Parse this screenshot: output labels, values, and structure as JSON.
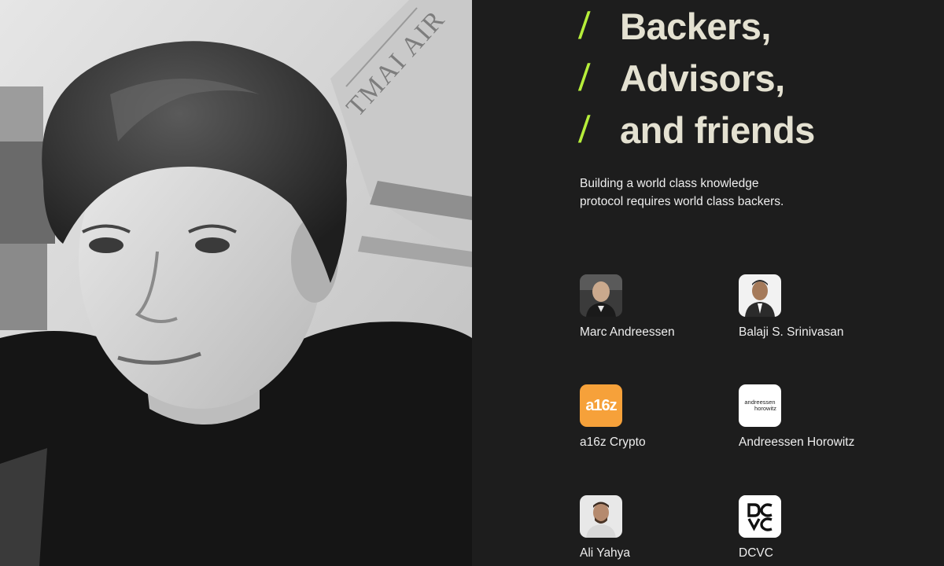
{
  "heading": {
    "lines": [
      "Backers,",
      "Advisors,",
      "and friends"
    ],
    "slash": "/"
  },
  "intro": "Building a world class knowledge protocol requires world class backers.",
  "backers": [
    {
      "name": "Marc Andreessen",
      "logo": "portrait"
    },
    {
      "name": "Balaji S. Srinivasan",
      "logo": "portrait"
    },
    {
      "name": "a16z Crypto",
      "logo": "a16z-logo",
      "logo_text": "a16z"
    },
    {
      "name": "Andreessen Horowitz",
      "logo": "ah-logo",
      "logo_text_1": "andreessen",
      "logo_text_2": "horowitz"
    },
    {
      "name": "Ali Yahya",
      "logo": "portrait"
    },
    {
      "name": "DCVC",
      "logo": "dcvc-logo"
    }
  ],
  "colors": {
    "background": "#1d1d1d",
    "accent": "#b6ee3a",
    "heading": "#e4e1d1",
    "a16z_orange": "#f6a13a"
  },
  "photo_panel": {
    "style": "grayscale portrait"
  }
}
